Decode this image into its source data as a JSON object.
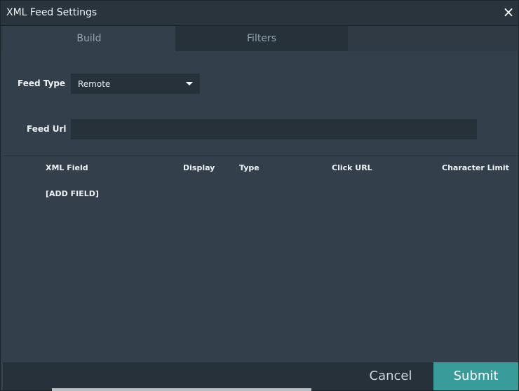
{
  "window": {
    "title": "XML Feed Settings",
    "close_icon": "×"
  },
  "tabs": [
    {
      "label": "Build"
    },
    {
      "label": "Filters"
    }
  ],
  "form": {
    "feed_type": {
      "label": "Feed Type",
      "value": "Remote"
    },
    "feed_url": {
      "label": "Feed Url",
      "value": ""
    }
  },
  "table": {
    "columns": [
      "XML Field",
      "Display",
      "Type",
      "Click URL",
      "Character Limit"
    ],
    "add_field": "[ADD FIELD]"
  },
  "footer": {
    "cancel": "Cancel",
    "submit": "Submit"
  },
  "colors": {
    "background": "#333f4a",
    "accent": "#3a9b9b",
    "field": "#27313a"
  }
}
